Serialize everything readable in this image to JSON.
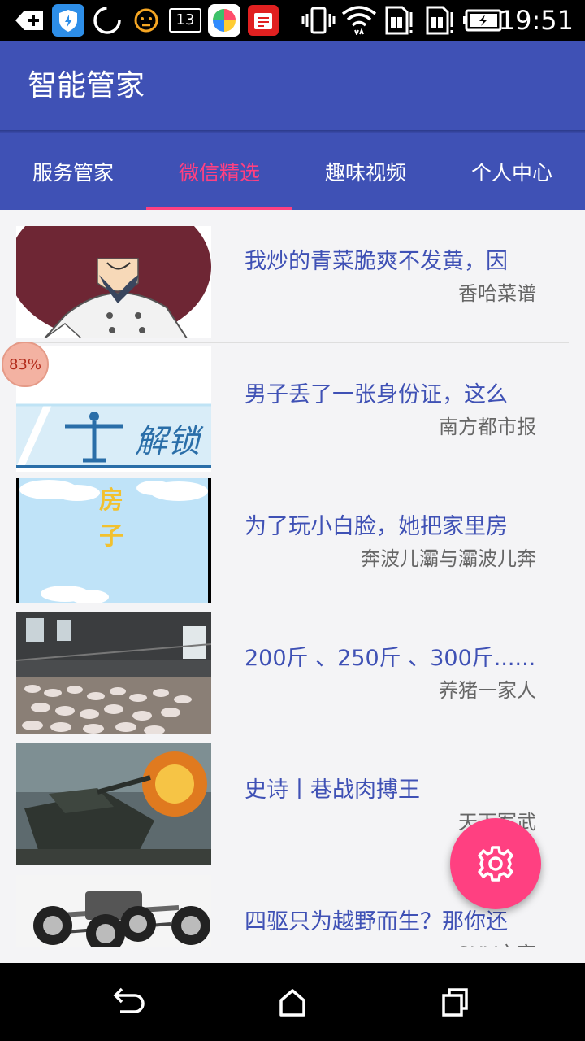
{
  "status_bar": {
    "time": "19:51",
    "notification_count": "13",
    "icons": [
      "back-add-icon",
      "shield-app-icon",
      "circle-loader-icon",
      "face-app-icon",
      "notification-count-icon",
      "colorful-app-icon",
      "red-app-icon",
      "vibrate-icon",
      "wifi-icon",
      "sim1-icon",
      "sim2-icon",
      "battery-icon"
    ]
  },
  "app_bar": {
    "title": "智能管家"
  },
  "tabs": [
    {
      "label": "服务管家"
    },
    {
      "label": "微信精选"
    },
    {
      "label": "趣味视频"
    },
    {
      "label": "个人中心"
    }
  ],
  "active_tab": "微信精选",
  "articles": [
    {
      "title": "我炒的青菜脆爽不发黄，因",
      "source": "香哈菜谱"
    },
    {
      "title": "男子丢了一张身份证，这么",
      "source": "南方都市报",
      "thumb_text": "解锁"
    },
    {
      "title": "为了玩小白脸，她把家里房",
      "source": "奔波儿灞与灞波儿奔",
      "thumb_text": "房子"
    },
    {
      "title": "200斤 、250斤 、300斤......",
      "source": "养猪一家人"
    },
    {
      "title": "史诗丨巷战肉搏王",
      "source": "天下军武"
    },
    {
      "title": "四驱只为越野而生？那你还",
      "source": "SUV之家"
    }
  ],
  "progress_badge": "83%",
  "colors": {
    "primary": "#3f51b5",
    "accent": "#ff4081"
  }
}
